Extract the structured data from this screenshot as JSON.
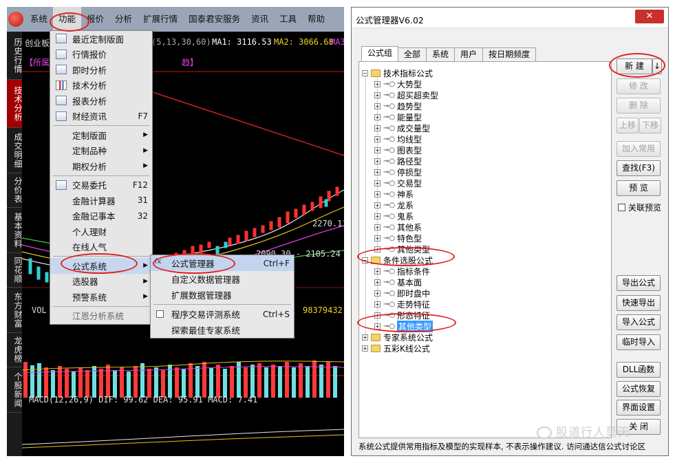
{
  "left": {
    "menubar": [
      "系统",
      "功能",
      "报价",
      "分析",
      "扩展行情",
      "国泰君安服务",
      "资讯",
      "工具",
      "帮助"
    ],
    "active_menu_index": 1,
    "side_tabs": [
      "历史行情",
      "技术分析",
      "成交明细",
      "分价表",
      "基本资料",
      "同花顺",
      "东方财富",
      "龙虎榜",
      "个股新闻"
    ],
    "chart_header": {
      "stock": "创业板指",
      "ma_params": "(5,13,30,60)",
      "ma1": "MA1: 3116.53",
      "ma2": "MA2: 3066.68",
      "ma3": "MA3"
    },
    "subheader": "【所属",
    "subheader2": "趋】",
    "price_labels": [
      "2270.11",
      "2090.30 - 2105.24"
    ],
    "volume_label": "VOL",
    "volume_value": "98379432.",
    "macd_label": "MACD(12,26,9) DIF: 99.62 DEA: 95.91 MACD: 7.41",
    "function_menu": [
      {
        "label": "最近定制版面",
        "key": "",
        "arrow": false
      },
      {
        "label": "行情报价",
        "key": "",
        "arrow": false
      },
      {
        "label": "即时分析",
        "key": "",
        "arrow": false
      },
      {
        "label": "技术分析",
        "key": "",
        "arrow": false
      },
      {
        "label": "报表分析",
        "key": "",
        "arrow": false
      },
      {
        "label": "财经资讯",
        "key": "F7",
        "arrow": false
      },
      {
        "label": "定制版面",
        "key": "",
        "arrow": true
      },
      {
        "label": "定制品种",
        "key": "",
        "arrow": true
      },
      {
        "label": "期权分析",
        "key": "",
        "arrow": true
      },
      {
        "label": "交易委托",
        "key": "F12",
        "arrow": false
      },
      {
        "label": "金融计算器",
        "key": "31",
        "arrow": false
      },
      {
        "label": "金融记事本",
        "key": "32",
        "arrow": false
      },
      {
        "label": "个人理财",
        "key": "",
        "arrow": false
      },
      {
        "label": "在线人气",
        "key": "",
        "arrow": false
      },
      {
        "label": "公式系统",
        "key": "",
        "arrow": true
      },
      {
        "label": "选股器",
        "key": "",
        "arrow": true
      },
      {
        "label": "预警系统",
        "key": "",
        "arrow": true
      },
      {
        "label": "江恩分析系统",
        "key": "",
        "arrow": false
      }
    ],
    "submenu": [
      {
        "label": "公式管理器",
        "key": "Ctrl+F"
      },
      {
        "label": "自定义数据管理器",
        "key": ""
      },
      {
        "label": "扩展数据管理器",
        "key": ""
      },
      {
        "label": "程序交易评测系统",
        "key": "Ctrl+S"
      },
      {
        "label": "探索最佳专家系统",
        "key": ""
      }
    ]
  },
  "right": {
    "title": "公式管理器V6.02",
    "close_label": "✕",
    "tabs": [
      "公式组",
      "全部",
      "系统",
      "用户",
      "按日期频度"
    ],
    "tree": {
      "group1": "技术指标公式",
      "group1_children": [
        "大势型",
        "超买超卖型",
        "趋势型",
        "能量型",
        "成交量型",
        "均线型",
        "图表型",
        "路径型",
        "停损型",
        "交易型",
        "神系",
        "龙系",
        "鬼系",
        "其他系",
        "特色型",
        "其他类型"
      ],
      "group2": "条件选股公式",
      "group2_children": [
        "指标条件",
        "基本面",
        "即时盘中",
        "走势特征",
        "形态特征",
        "其他类型"
      ],
      "group3": "专家系统公式",
      "group4": "五彩K线公式"
    },
    "buttons": {
      "new": "新 建",
      "new_arrow": "↓",
      "modify": "修 改",
      "delete": "删 除",
      "move_up": "上移",
      "move_down": "下移",
      "add_common": "加入常用",
      "find": "查找(F3)",
      "preview": "预 览",
      "link_preview": "关联预览",
      "export": "导出公式",
      "quick_export": "快速导出",
      "import": "导入公式",
      "temp_import": "临时导入",
      "dll": "DLL函数",
      "restore": "公式恢复",
      "ui_settings": "界面设置",
      "close": "关 闭"
    },
    "status": "系统公式提供常用指标及模型的实现样本, 不表示操作建议.  访问通达信公式讨论区"
  },
  "watermark": "股道行人莫天"
}
